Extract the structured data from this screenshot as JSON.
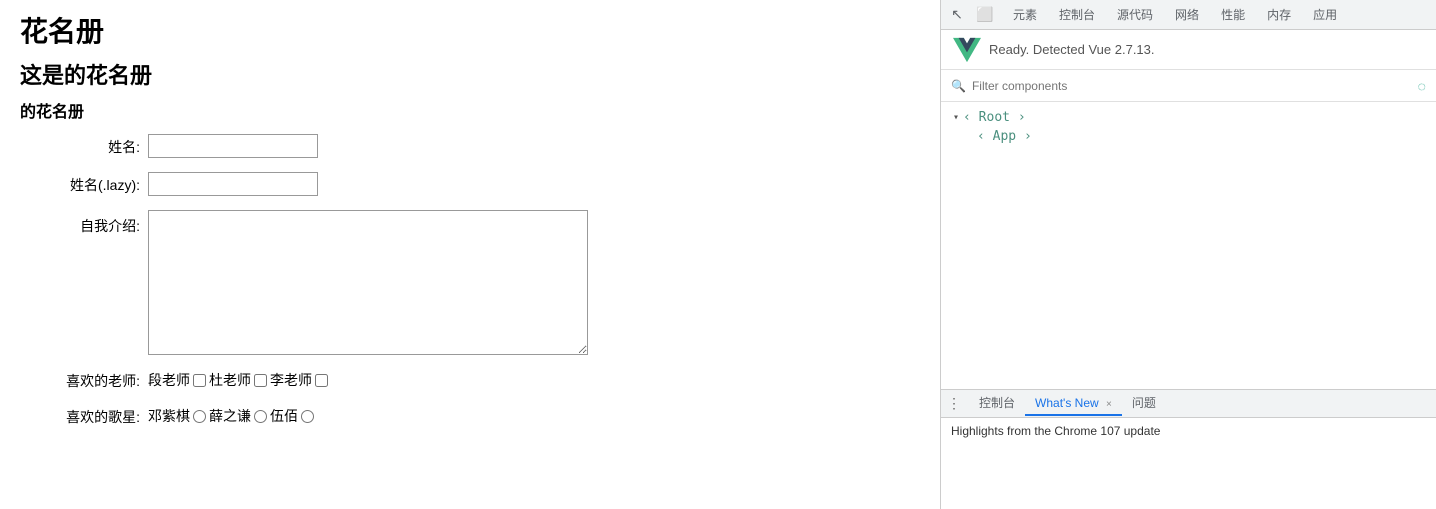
{
  "page": {
    "title": "花名册",
    "subtitle": "这是的花名册",
    "section_title": "的花名册"
  },
  "form": {
    "name_label": "姓名:",
    "name_lazy_label": "姓名(.lazy):",
    "intro_label": "自我介绍:",
    "teachers_label": "喜欢的老师:",
    "singers_label": "喜欢的歌星:",
    "name_value": "",
    "name_lazy_value": "",
    "intro_value": "",
    "teachers": [
      {
        "label": "段老师",
        "value": "duan"
      },
      {
        "label": "杜老师",
        "value": "du"
      },
      {
        "label": "李老师",
        "value": "li"
      }
    ],
    "singers": [
      {
        "label": "邓紫棋",
        "value": "deng"
      },
      {
        "label": "薛之谦",
        "value": "xue"
      },
      {
        "label": "伍佰",
        "value": "wu"
      }
    ]
  },
  "devtools": {
    "toolbar_tabs": [
      "元素",
      "控制台",
      "源代码",
      "网络",
      "性能",
      "内存",
      "应用"
    ],
    "vue_ready_text": "Ready. Detected Vue 2.7.13.",
    "filter_placeholder": "Filter components",
    "tree": {
      "root": "‹ Root ›",
      "app": "‹ App ›"
    },
    "bottom_tabs": [
      "控制台",
      "What's New",
      "问题"
    ],
    "active_bottom_tab": "What's New",
    "bottom_content": "Highlights from the Chrome 107 update"
  },
  "icons": {
    "cursor": "↖",
    "inspect": "⬜",
    "search": "🔍",
    "refresh": "◌",
    "three_dots": "⋮",
    "close": "×",
    "triangle_down": "▾",
    "triangle_right": "▸"
  }
}
